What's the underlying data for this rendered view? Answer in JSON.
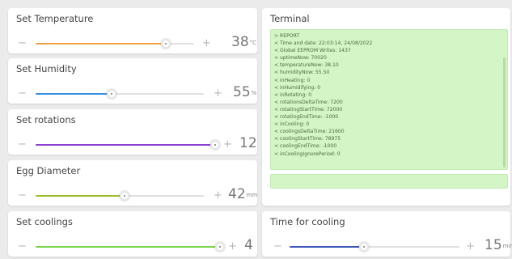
{
  "sliders": [
    {
      "title": "Set Temperature",
      "value": "38",
      "unit": "°C",
      "fraction": 0.82,
      "color": "#f0a24a"
    },
    {
      "title": "Set Humidity",
      "value": "55",
      "unit": "%",
      "fraction": 0.45,
      "color": "#3b8de0"
    },
    {
      "title": "Set rotations",
      "value": "12",
      "unit": "",
      "fraction": 0.99,
      "color": "#8b3fd1"
    },
    {
      "title": "Egg Diameter",
      "value": "42",
      "unit": "mm",
      "fraction": 0.53,
      "color": "#9bbd2a"
    },
    {
      "title": "Set coolings",
      "value": "4",
      "unit": "",
      "fraction": 0.99,
      "color": "#79d64c"
    }
  ],
  "cooling": {
    "title": "Time for cooling",
    "value": "15",
    "unit": "min",
    "fraction": 0.44,
    "color": "#3c57b5"
  },
  "terminal": {
    "title": "Terminal",
    "lines": [
      "> REPORT",
      "< Time and date: 22:03:14, 24/08/2022",
      "< Global EEPROM Writes: 1437",
      "< uptimeNow: 70020",
      "< temperatureNow: 38.10",
      "< humidityNow: 55.50",
      "< inHeating: 0",
      "< inHumidifying: 0",
      "< inRotating: 0",
      "< rotationsDeltaTime: 7200",
      "< rotatingStartTime: 72000",
      "< rotatingEndTime: -1000",
      "< inCooling: 0",
      "< coolingsDeltaTime: 21600",
      "< coolingStartTime: 78975",
      "< coolingEndTime: -1000",
      "< inCoolingIgnorePeriod: 0"
    ],
    "input_value": ""
  },
  "icons": {
    "minus": "−",
    "plus": "+"
  }
}
